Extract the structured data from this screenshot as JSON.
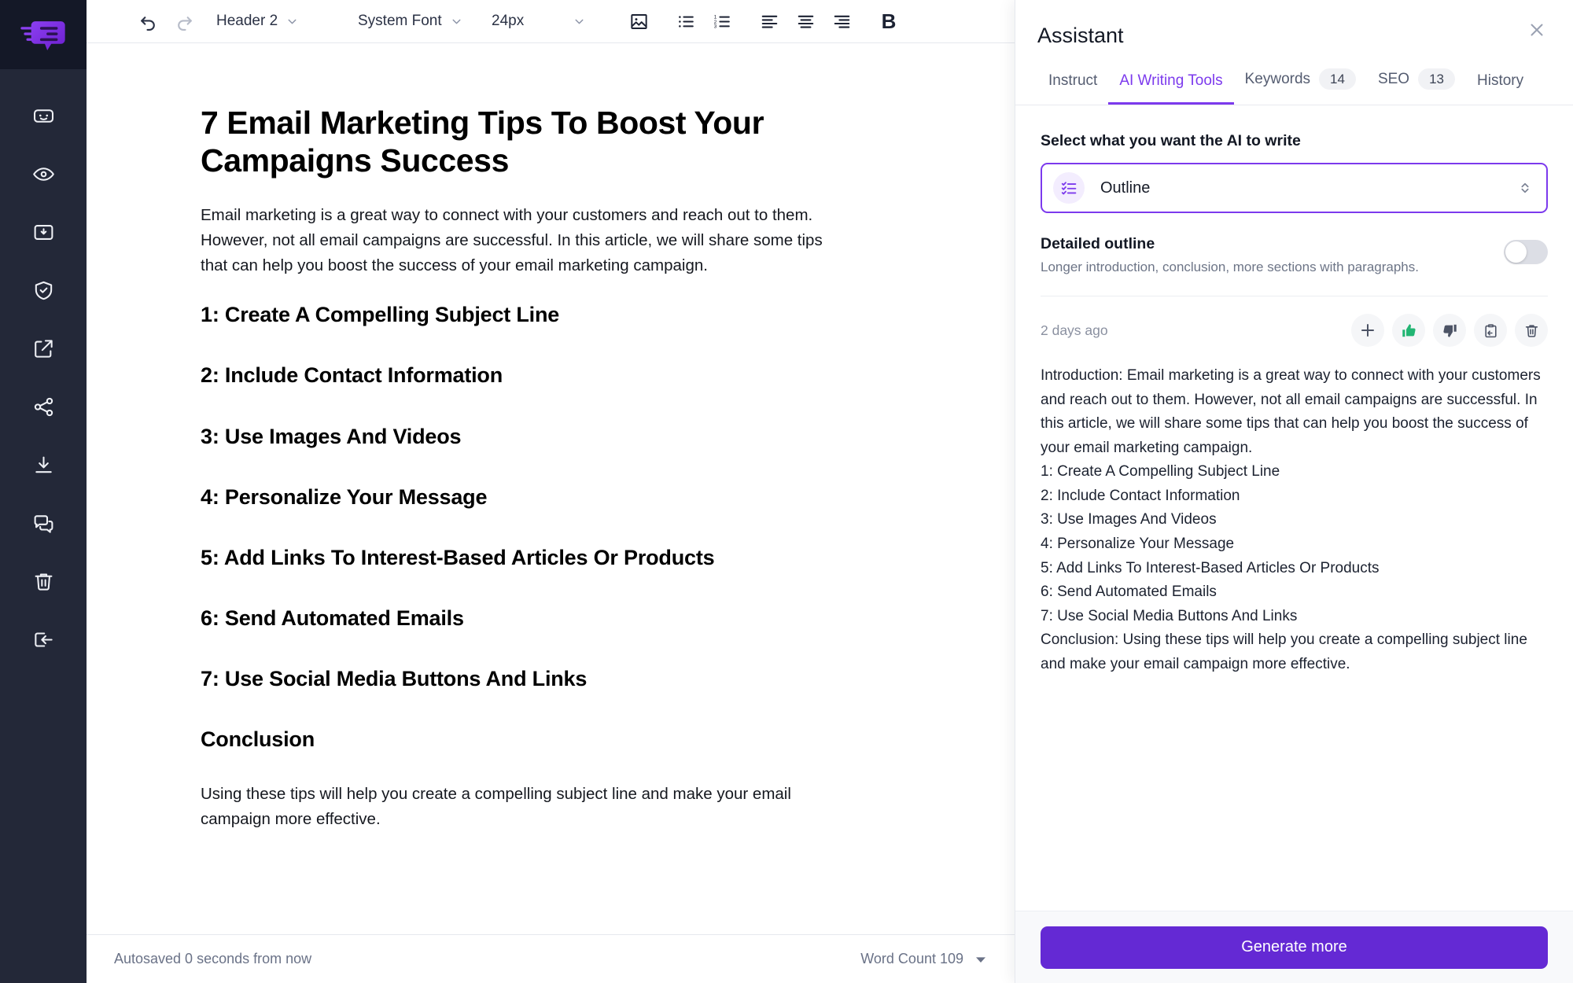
{
  "brand": {
    "logo_name": "speech-bubble-logo",
    "accent": "#7c3aed",
    "accent_dark": "#6429d4",
    "rail_bg": "#232838"
  },
  "sidebar": {
    "items": [
      {
        "icon": "robot-icon",
        "name": "sidebar-item-robot"
      },
      {
        "icon": "eye-icon",
        "name": "sidebar-item-preview"
      },
      {
        "icon": "inbox-download-icon",
        "name": "sidebar-item-import"
      },
      {
        "icon": "shield-check-icon",
        "name": "sidebar-item-plagiarism"
      },
      {
        "icon": "external-link-icon",
        "name": "sidebar-item-open-external"
      },
      {
        "icon": "share-icon",
        "name": "sidebar-item-share"
      },
      {
        "icon": "download-icon",
        "name": "sidebar-item-download"
      },
      {
        "icon": "comments-icon",
        "name": "sidebar-item-comments"
      },
      {
        "icon": "trash-icon",
        "name": "sidebar-item-delete"
      },
      {
        "icon": "logout-icon",
        "name": "sidebar-item-exit"
      }
    ]
  },
  "toolbar": {
    "undo": "undo-icon",
    "redo": "redo-icon",
    "style_select": "Header 2",
    "font_select": "System Font",
    "size_select": "24px",
    "image": "image-icon",
    "bullet_list": "bullet-list-icon",
    "numbered_list": "numbered-list-icon",
    "align_left": "align-left-icon",
    "align_center": "align-center-icon",
    "align_right": "align-right-icon",
    "bold_label": "B"
  },
  "document": {
    "title": "7 Email Marketing Tips To Boost Your Campaigns Success",
    "intro": "Email marketing is a great way to connect with your customers and reach out to them. However, not all email campaigns are successful. In this article, we will share some tips that can help you boost the success of your email marketing campaign.",
    "headings": [
      "1: Create A Compelling Subject Line",
      "2: Include Contact Information",
      "3: Use Images And Videos",
      "4: Personalize Your Message",
      "5: Add Links To Interest-Based Articles Or Products",
      "6: Send Automated Emails",
      "7: Use Social Media Buttons And Links",
      "Conclusion"
    ],
    "conclusion": "Using these tips will help you create a compelling subject line and make your email campaign more effective."
  },
  "statusbar": {
    "autosave": "Autosaved 0 seconds from now",
    "word_count": "Word Count 109"
  },
  "assistant": {
    "title": "Assistant",
    "close_icon": "close-icon",
    "tabs": [
      {
        "label": "Instruct",
        "badge": null,
        "active": false
      },
      {
        "label": "AI Writing Tools",
        "badge": null,
        "active": true
      },
      {
        "label": "Keywords",
        "badge": "14",
        "active": false
      },
      {
        "label": "SEO",
        "badge": "13",
        "active": false
      },
      {
        "label": "History",
        "badge": null,
        "active": false
      }
    ],
    "section_label": "Select what you want the AI to write",
    "select": {
      "value": "Outline",
      "icon": "checklist-icon"
    },
    "detailed": {
      "title": "Detailed outline",
      "subtitle": "Longer introduction, conclusion, more sections with paragraphs.",
      "enabled": false
    },
    "result": {
      "timestamp": "2 days ago",
      "actions": [
        {
          "icon": "plus-icon",
          "name": "insert-button"
        },
        {
          "icon": "thumbs-up-icon",
          "name": "thumbs-up-button"
        },
        {
          "icon": "thumbs-down-icon",
          "name": "thumbs-down-button"
        },
        {
          "icon": "clipboard-paste-icon",
          "name": "copy-button"
        },
        {
          "icon": "trash-icon",
          "name": "delete-button"
        }
      ],
      "lines": [
        "Introduction: Email marketing is a great way to connect with your customers and reach out to them. However, not all email campaigns are successful. In this article, we will share some tips that can help you boost the success of your email marketing campaign.",
        "1: Create A Compelling Subject Line",
        "2: Include Contact Information",
        "3: Use Images And Videos",
        "4: Personalize Your Message",
        "5: Add Links To Interest-Based Articles Or Products",
        "6: Send Automated Emails",
        "7: Use Social Media Buttons And Links",
        "Conclusion: Using these tips will help you create a compelling subject line and make your email campaign more effective."
      ]
    },
    "generate_label": "Generate more"
  }
}
